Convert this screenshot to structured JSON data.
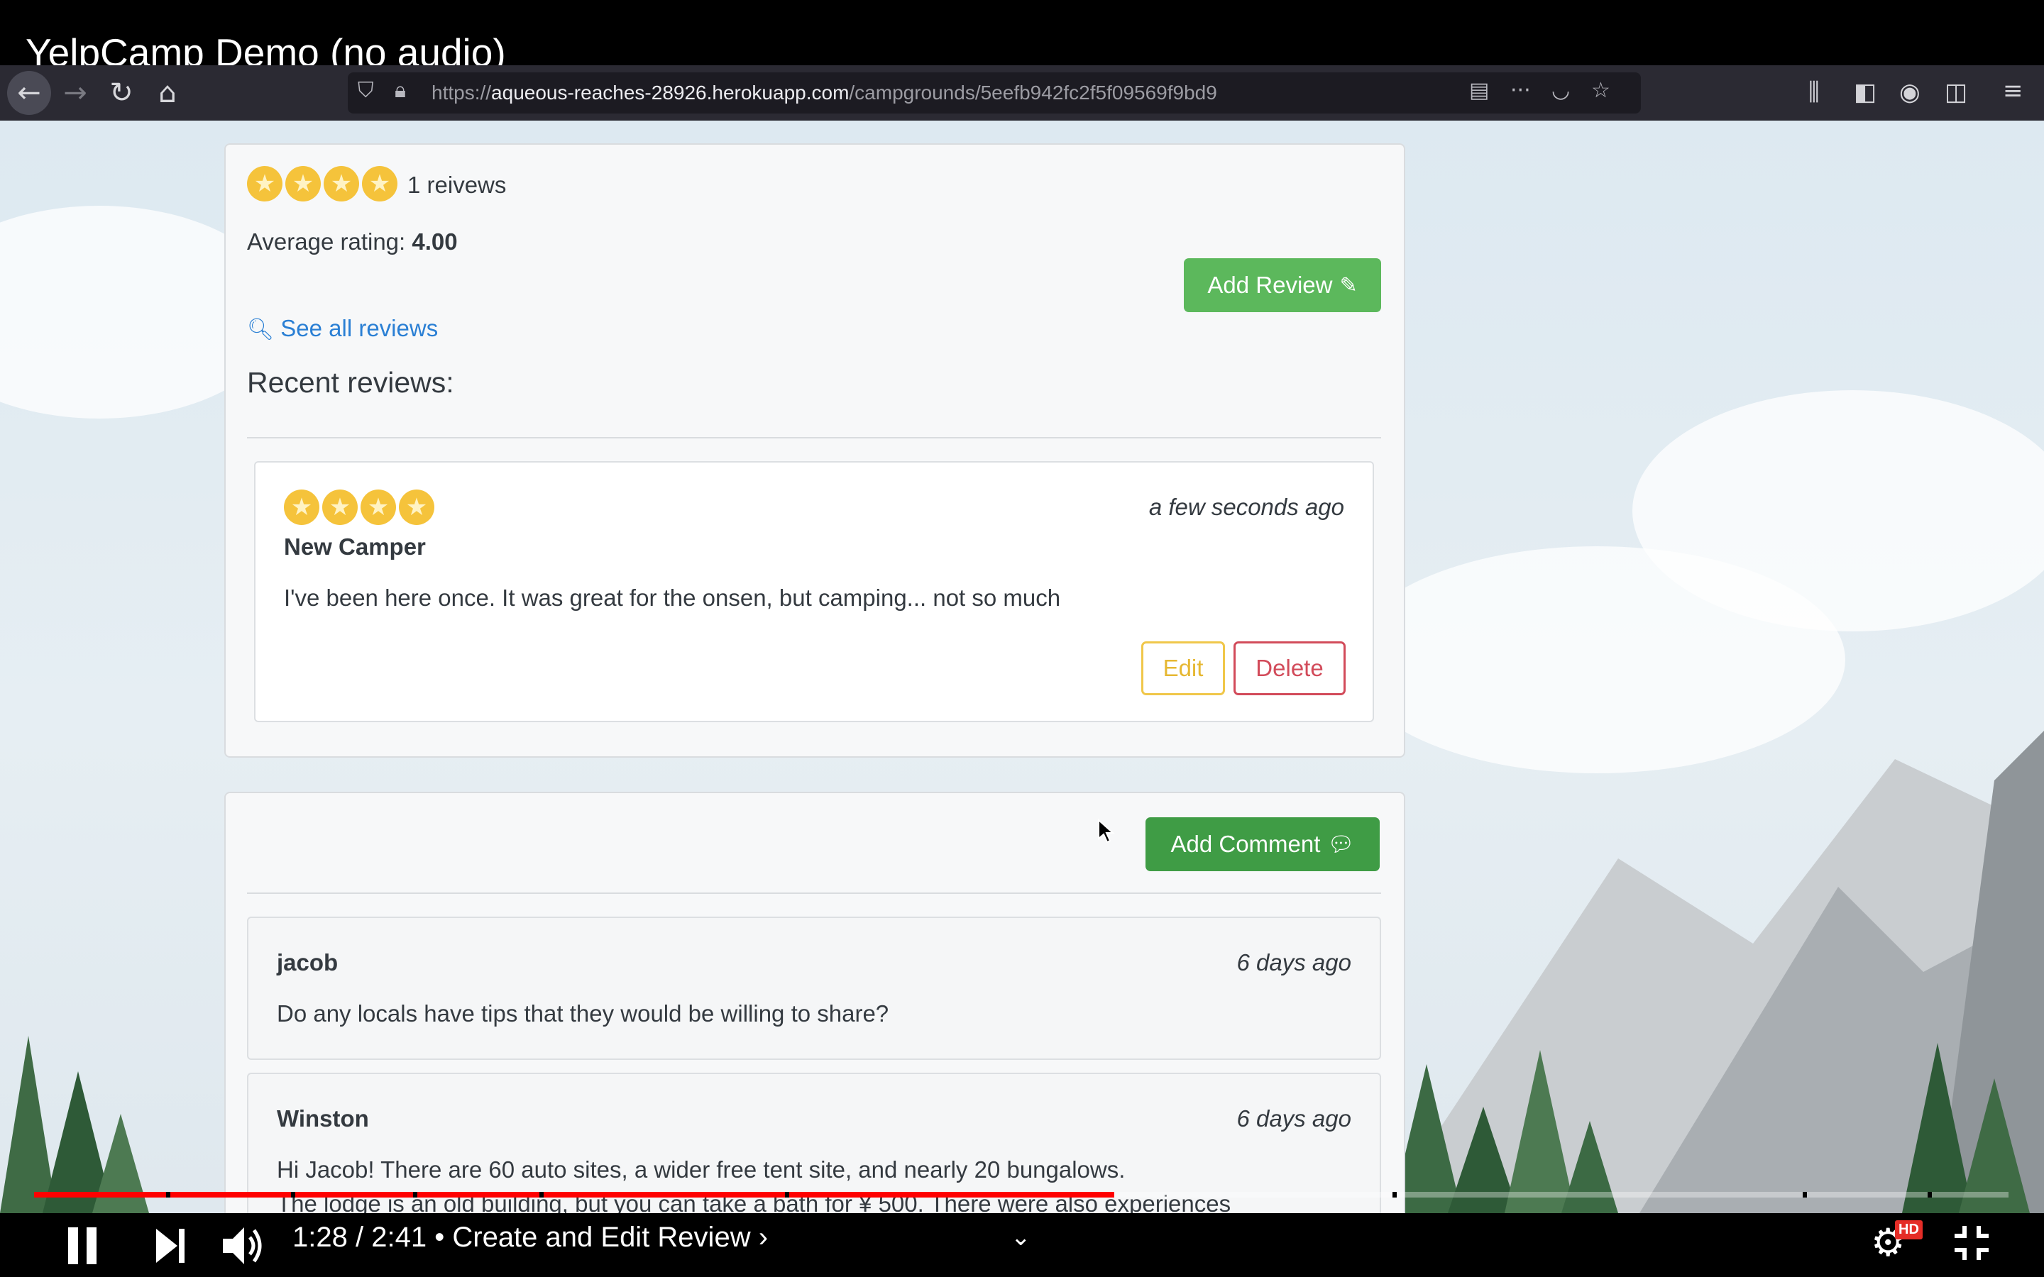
{
  "video": {
    "title": "YelpCamp Demo (no audio)",
    "time_current": "1:28",
    "time_total": "2:41",
    "time_separator": "/",
    "chapter_bullet": "•",
    "chapter": "Create and Edit Review",
    "chapter_chevron": "›",
    "progress": 0.547,
    "quality_badge": "HD",
    "accent_color": "#ff0000"
  },
  "browser": {
    "url_scheme": "https://",
    "url_host": "aqueous-reaches-28926.herokuapp.com",
    "url_path": "/campgrounds/5eefb942fc2f5f09569f9bd9"
  },
  "reviews": {
    "stars": 4,
    "count_label": "1 reivews",
    "average_label": "Average rating:",
    "average_value": "4.00",
    "add_review_label": "Add Review",
    "see_all_label": "See all reviews",
    "recent_heading": "Recent reviews:",
    "items": [
      {
        "stars": 4,
        "author": "New Camper",
        "time": "a few seconds ago",
        "text": "I've been here once. It was great for the onsen, but camping... not so much",
        "edit_label": "Edit",
        "delete_label": "Delete"
      }
    ]
  },
  "comments": {
    "add_comment_label": "Add Comment",
    "items": [
      {
        "author": "jacob",
        "time": "6 days ago",
        "text": "Do any locals have tips that they would be willing to share?"
      },
      {
        "author": "Winston",
        "time": "6 days ago",
        "text": "Hi Jacob! There are 60 auto sites, a wider free tent site, and nearly 20 bungalows.",
        "text2": "The lodge is an old building, but you can take a bath for ¥ 500. There were also experiences"
      }
    ]
  },
  "colors": {
    "success": "#5cb85c",
    "link": "#2a7fd4",
    "star": "#f5c33b",
    "warning": "#f0c74a",
    "danger": "#d24b5a"
  }
}
